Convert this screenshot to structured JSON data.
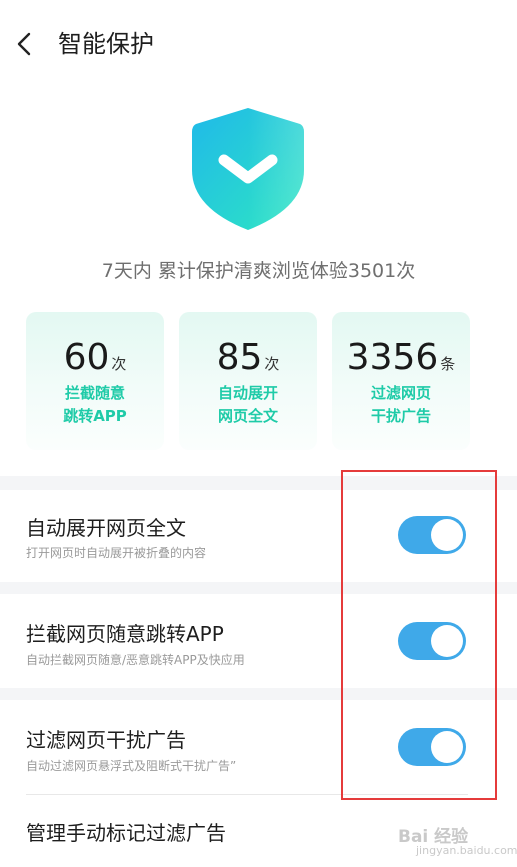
{
  "header": {
    "title": "智能保护",
    "back_icon": "chevron-left-icon"
  },
  "hero": {
    "icon": "shield-check-icon",
    "summary": "7天内 累计保护清爽浏览体验3501次"
  },
  "stats": [
    {
      "value": "60",
      "unit": "次",
      "label_line1": "拦截随意",
      "label_line2": "跳转APP"
    },
    {
      "value": "85",
      "unit": "次",
      "label_line1": "自动展开",
      "label_line2": "网页全文"
    },
    {
      "value": "3356",
      "unit": "条",
      "label_line1": "过滤网页",
      "label_line2": "干扰广告"
    }
  ],
  "settings": [
    {
      "title": "自动展开网页全文",
      "desc": "打开网页时自动展开被折叠的内容",
      "enabled": true
    },
    {
      "title": "拦截网页随意跳转APP",
      "desc": "自动拦截网页随意/恶意跳转APP及快应用",
      "enabled": true
    },
    {
      "title": "过滤网页干扰广告",
      "desc": "自动过滤网页悬浮式及阻断式干扰广告”",
      "enabled": true
    }
  ],
  "manual": {
    "title": "管理手动标记过滤广告"
  },
  "watermark": {
    "line1": "Bai 经验",
    "line2": "jingyan.baidu.com"
  },
  "colors": {
    "accent": "#1fcba8",
    "toggle_on": "#3fa9e9",
    "highlight": "#e53b3b"
  }
}
